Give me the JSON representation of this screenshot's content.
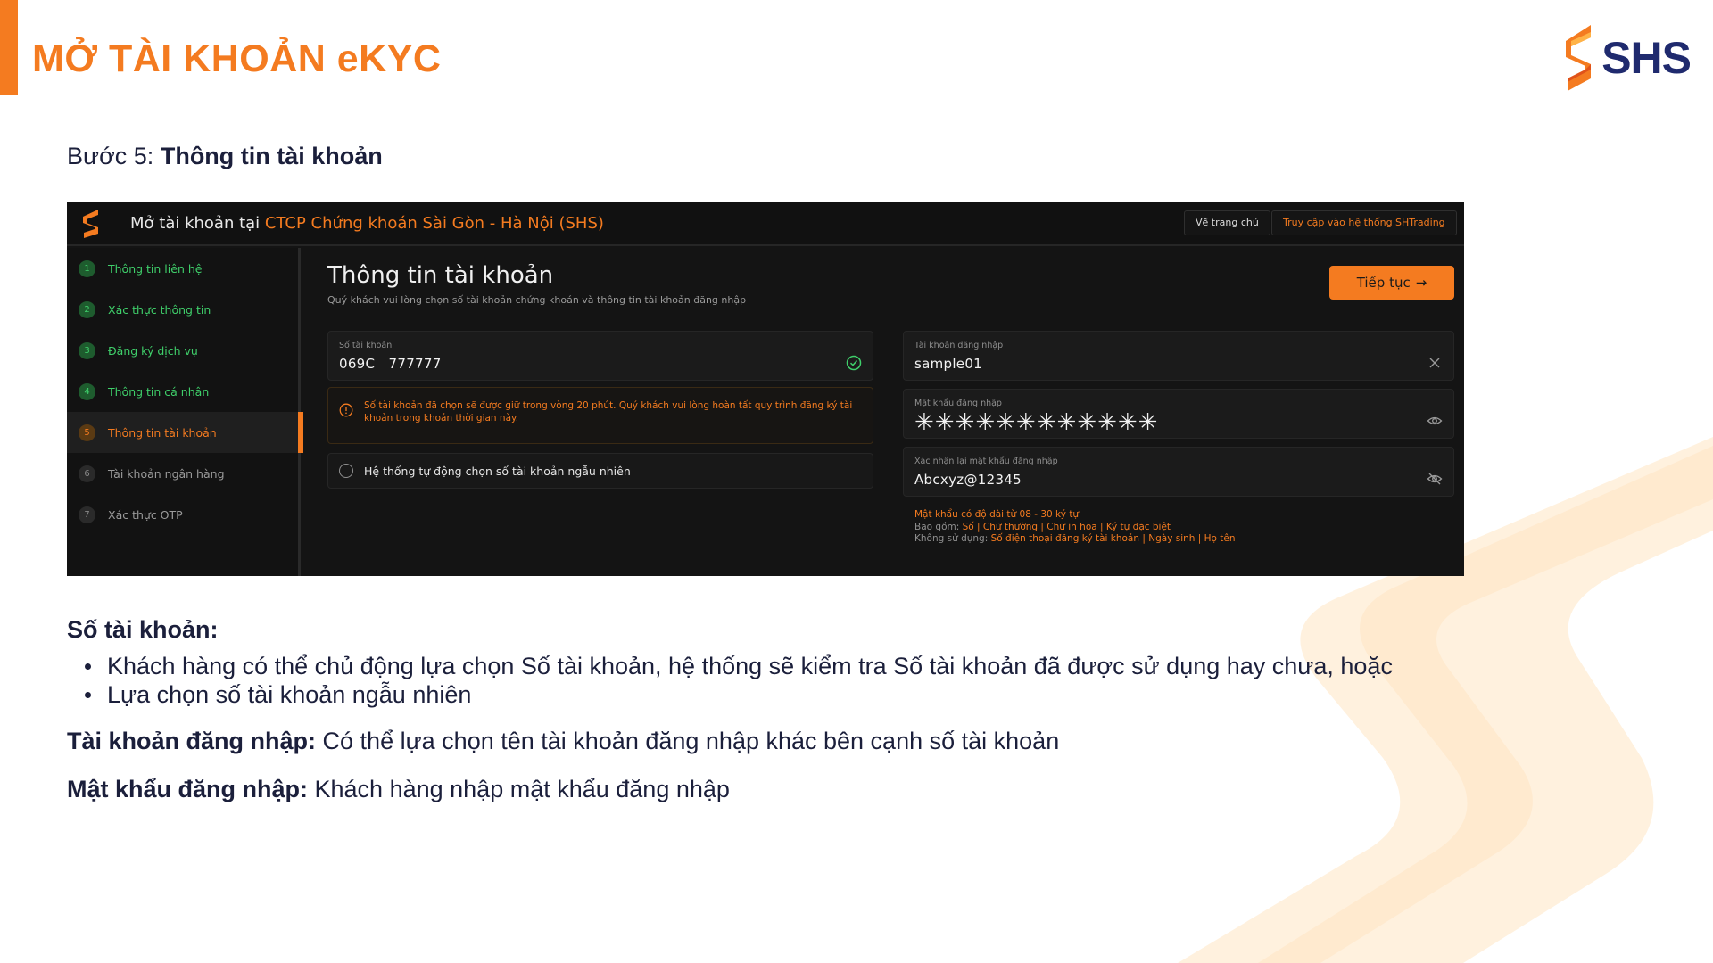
{
  "slide": {
    "title": "MỞ TÀI KHOẢN eKYC",
    "brand": "SHS",
    "step_prefix": "Bước 5:",
    "step_title": "Thông tin tài khoản",
    "accent_color": "#f47b20",
    "brand_color": "#1f2a6e"
  },
  "app": {
    "header_prefix": "Mở tài khoản tại",
    "header_org": "CTCP Chứng khoán Sài Gòn - Hà Nội (SHS)",
    "home_button": "Về trang chủ",
    "shtrading_button": "Truy cập vào hệ thống SHTrading",
    "sidebar": [
      {
        "num": "1",
        "label": "Thông tin liên hệ",
        "state": "done"
      },
      {
        "num": "2",
        "label": "Xác thực thông tin",
        "state": "done"
      },
      {
        "num": "3",
        "label": "Đăng ký dịch vụ",
        "state": "done"
      },
      {
        "num": "4",
        "label": "Thông tin cá nhân",
        "state": "done"
      },
      {
        "num": "5",
        "label": "Thông tin tài khoản",
        "state": "current"
      },
      {
        "num": "6",
        "label": "Tài khoản ngân hàng",
        "state": "todo"
      },
      {
        "num": "7",
        "label": "Xác thực OTP",
        "state": "todo"
      }
    ],
    "main": {
      "title": "Thông tin tài khoản",
      "subtitle": "Quý khách vui lòng chọn số tài khoản chứng khoán và thông tin tài khoản đăng nhập",
      "continue_button": "Tiếp tục",
      "account_number": {
        "label": "Số tài khoản",
        "value": "069C   777777"
      },
      "warning": "Số tài khoản đã chọn sẽ được giữ trong vòng 20 phút. Quý khách vui lòng hoàn tất quy trình đăng ký tài khoản trong khoản thời gian này.",
      "random_option": "Hệ thống tự động chọn số tài khoản ngẫu nhiên",
      "login_account": {
        "label": "Tài khoản đăng nhập",
        "value": "sample01"
      },
      "password": {
        "label": "Mật khẩu đăng nhập",
        "value": "✳✳✳✳✳✳✳✳✳✳✳✳"
      },
      "confirm_password": {
        "label": "Xác nhận lại mật khẩu đăng nhập",
        "value": "Abcxyz@12345"
      },
      "rules": {
        "line1": "Mật khẩu có độ dài từ 08 - 30 ký tự",
        "line2_prefix": "Bao gồm:",
        "line2_value": "Số | Chữ thường | Chữ in hoa | Ký tự đặc biệt",
        "line3_prefix": "Không sử dụng:",
        "line3_value": "Số điện thoại đăng ký tài khoản | Ngày sinh | Họ tên"
      }
    }
  },
  "notes": {
    "account_heading": "Số tài khoản:",
    "bullets": [
      "Khách hàng có thể chủ động lựa chọn Số tài khoản, hệ thống sẽ kiểm tra Số tài khoản đã được sử dụng hay chưa, hoặc",
      "Lựa chọn số tài khoản ngẫu nhiên"
    ],
    "login_heading": "Tài khoản đăng nhập:",
    "login_text": "Có thể lựa chọn tên tài khoản đăng nhập khác bên cạnh số tài khoản",
    "password_heading": "Mật khẩu đăng nhập:",
    "password_text": "Khách hàng nhập mật khẩu đăng nhập"
  }
}
